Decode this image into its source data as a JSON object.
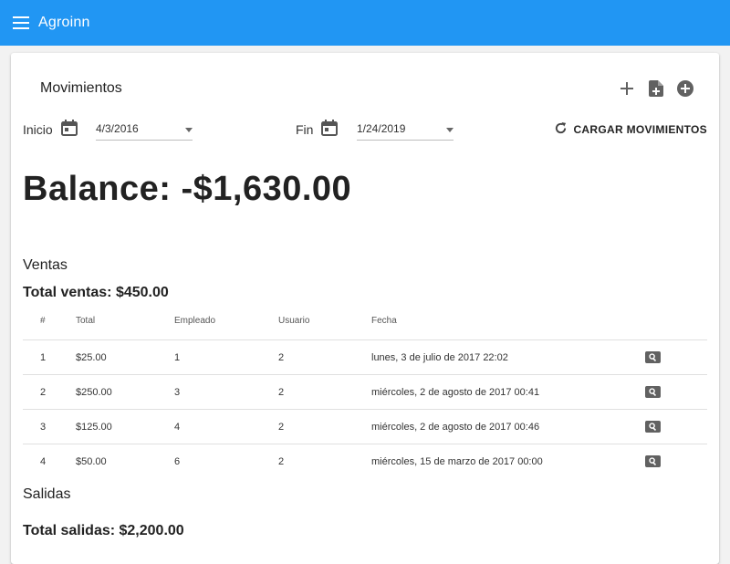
{
  "appbar": {
    "title": "Agroinn",
    "menu_icon": "menu-icon"
  },
  "card": {
    "title": "Movimientos",
    "actions": [
      "add-icon",
      "add-file-icon",
      "add-circle-icon"
    ]
  },
  "dates": {
    "start_label": "Inicio",
    "start_value": "4/3/2016",
    "end_label": "Fin",
    "end_value": "1/24/2019",
    "load_button": "CARGAR MOVIMIENTOS"
  },
  "balance": {
    "text": "Balance: -$1,630.00"
  },
  "ventas": {
    "heading": "Ventas",
    "total": "Total ventas: $450.00",
    "columns": [
      "#",
      "Total",
      "Empleado",
      "Usuario",
      "Fecha"
    ],
    "rows": [
      {
        "num": "1",
        "total": "$25.00",
        "empleado": "1",
        "usuario": "2",
        "fecha": "lunes, 3 de julio de 2017 22:02"
      },
      {
        "num": "2",
        "total": "$250.00",
        "empleado": "3",
        "usuario": "2",
        "fecha": "miércoles, 2 de agosto de 2017 00:41"
      },
      {
        "num": "3",
        "total": "$125.00",
        "empleado": "4",
        "usuario": "2",
        "fecha": "miércoles, 2 de agosto de 2017 00:46"
      },
      {
        "num": "4",
        "total": "$50.00",
        "empleado": "6",
        "usuario": "2",
        "fecha": "miércoles, 15 de marzo de 2017 00:00"
      }
    ]
  },
  "salidas": {
    "heading": "Salidas",
    "total": "Total salidas: $2,200.00"
  },
  "colors": {
    "appbar": "#2196f3",
    "icon_button": "#616161"
  }
}
